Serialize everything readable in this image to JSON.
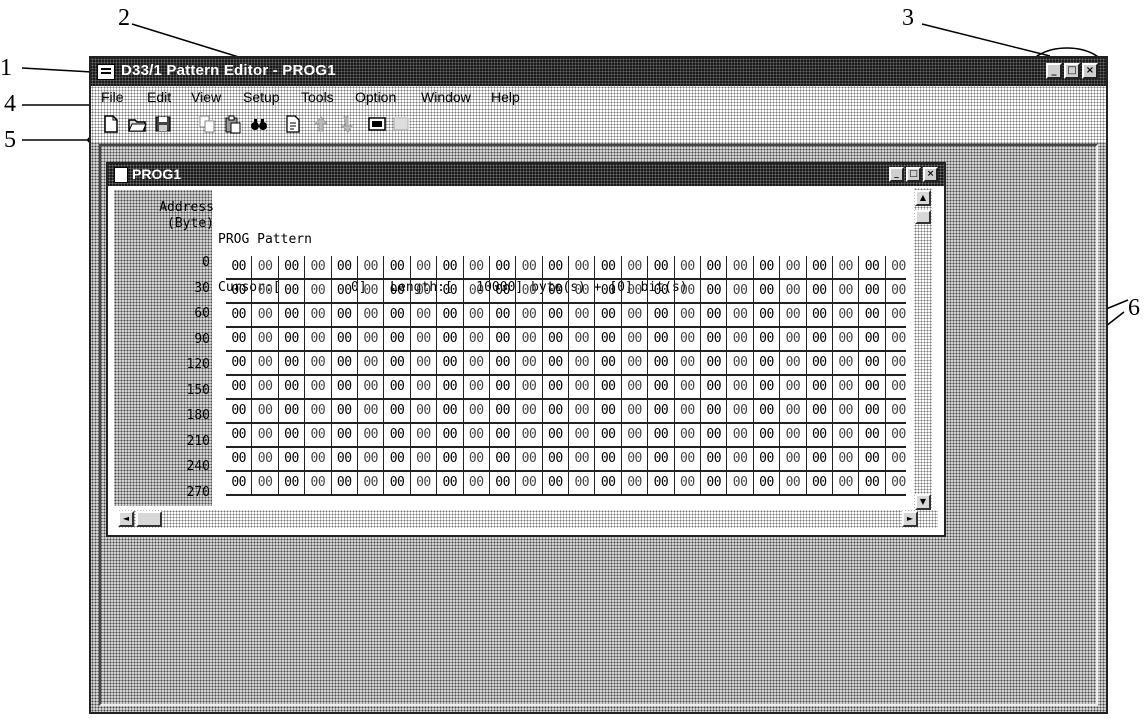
{
  "callouts": [
    "1",
    "2",
    "3",
    "4",
    "5",
    "6"
  ],
  "app": {
    "title": "D33/1 Pattern Editor - PROG1",
    "icon": "app-window-icon",
    "window_buttons": [
      "_",
      "□",
      "×"
    ]
  },
  "menu": {
    "items": [
      "File",
      "Edit",
      "View",
      "Setup",
      "Tools",
      "Option",
      "Window",
      "Help"
    ]
  },
  "toolbar": {
    "buttons": [
      "new-icon",
      "open-icon",
      "save-icon",
      "copy-icon",
      "paste-icon",
      "find-icon",
      "document-icon",
      "arrow-up-icon",
      "arrow-down-icon",
      "binary-icon",
      "display-icon"
    ]
  },
  "child": {
    "title": "PROG1",
    "window_buttons": [
      "_",
      "□",
      "×"
    ],
    "address_header_line1": "Address",
    "address_header_line2": "(Byte)",
    "pattern_header_line1": "PROG Pattern",
    "pattern_header_line2": "Cursor:[         0]   Length:[   10000] byte(s) + [0] bit(s)",
    "addresses": [
      "0",
      "30",
      "60",
      "90",
      "120",
      "150",
      "180",
      "210",
      "240",
      "270"
    ],
    "cell_value": "00",
    "columns": 26
  },
  "scrollbar": {
    "up": "▲",
    "down": "▼",
    "left": "◄",
    "right": "►"
  }
}
